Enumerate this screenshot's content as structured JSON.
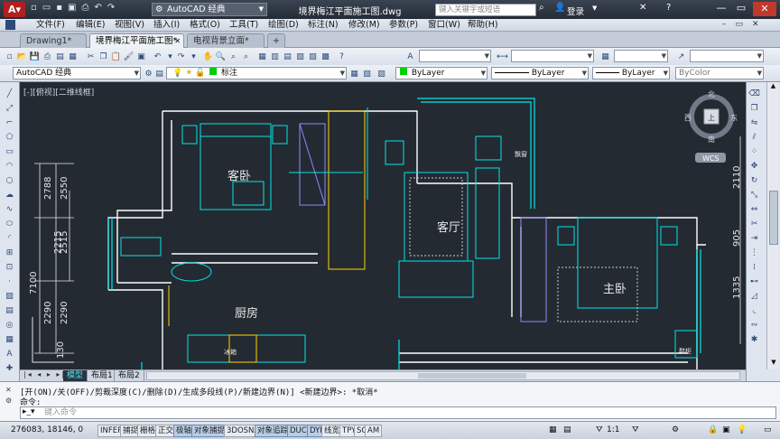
{
  "window": {
    "title": "境界梅江平面施工图.dwg",
    "workspace": "AutoCAD 经典",
    "search_placeholder": "键入关键字或短语",
    "login_label": "登录"
  },
  "menu": [
    "文件(F)",
    "编辑(E)",
    "视图(V)",
    "插入(I)",
    "格式(O)",
    "工具(T)",
    "绘图(D)",
    "标注(N)",
    "修改(M)",
    "参数(P)",
    "窗口(W)",
    "帮助(H)"
  ],
  "doc_tabs": [
    {
      "label": "Drawing1*",
      "active": false
    },
    {
      "label": "境界梅江平面施工图*",
      "active": true
    },
    {
      "label": "电视背景立面*",
      "active": false
    }
  ],
  "toolbar2": {
    "workspace": "AutoCAD 经典",
    "layer": "标注",
    "color": "ByLayer",
    "linetype": "ByLayer",
    "lineweight": "ByLayer",
    "plotstyle": "ByColor"
  },
  "viewport_label": "[-][俯视][二维线框]",
  "viewcube": {
    "north": "北",
    "south": "南",
    "east": "东",
    "west": "西",
    "center": "上",
    "wcs": "WCS"
  },
  "rooms": {
    "guest_bedroom": "客卧",
    "living_room": "客厅",
    "master_bedroom": "主卧",
    "kitchen": "厨房",
    "bay_window": "飘窗",
    "fridge": "冰箱",
    "shoe_cabinet": "鞋柜"
  },
  "dimensions_left": [
    "2788",
    "2550",
    "2515",
    "2215",
    "7100",
    "2290",
    "2290",
    "130"
  ],
  "dimensions_right": [
    "2110",
    "905",
    "1335"
  ],
  "layout_tabs": [
    "模型",
    "布局1",
    "布局2"
  ],
  "command": {
    "history": "[开(ON)/关(OFF)/剪裁深度(C)/删除(D)/生成多段线(P)/新建边界(N)] <新建边界>: *取消*",
    "prompt": "命令:",
    "placeholder": "键入命令"
  },
  "status": {
    "coords": "276083, 18146, 0",
    "toggles": [
      {
        "label": "INFER",
        "on": false
      },
      {
        "label": "捕捉",
        "on": false
      },
      {
        "label": "栅格",
        "on": false
      },
      {
        "label": "正交",
        "on": false
      },
      {
        "label": "极轴",
        "on": true
      },
      {
        "label": "对象捕捉",
        "on": true
      },
      {
        "label": "3DOSNAP",
        "on": false
      },
      {
        "label": "对象追踪",
        "on": true
      },
      {
        "label": "DUCS",
        "on": true
      },
      {
        "label": "DYN",
        "on": true
      },
      {
        "label": "线宽",
        "on": false
      },
      {
        "label": "TPY",
        "on": false
      },
      {
        "label": "SC",
        "on": false
      },
      {
        "label": "AM",
        "on": false
      }
    ],
    "scale": "1:1"
  },
  "colors": {
    "accent": "#00c8c8",
    "canvas": "#242a32",
    "wall": "#ffffff",
    "furniture": "#00e6e6",
    "highlight": "#ffd700",
    "door": "#c8c8ff"
  }
}
